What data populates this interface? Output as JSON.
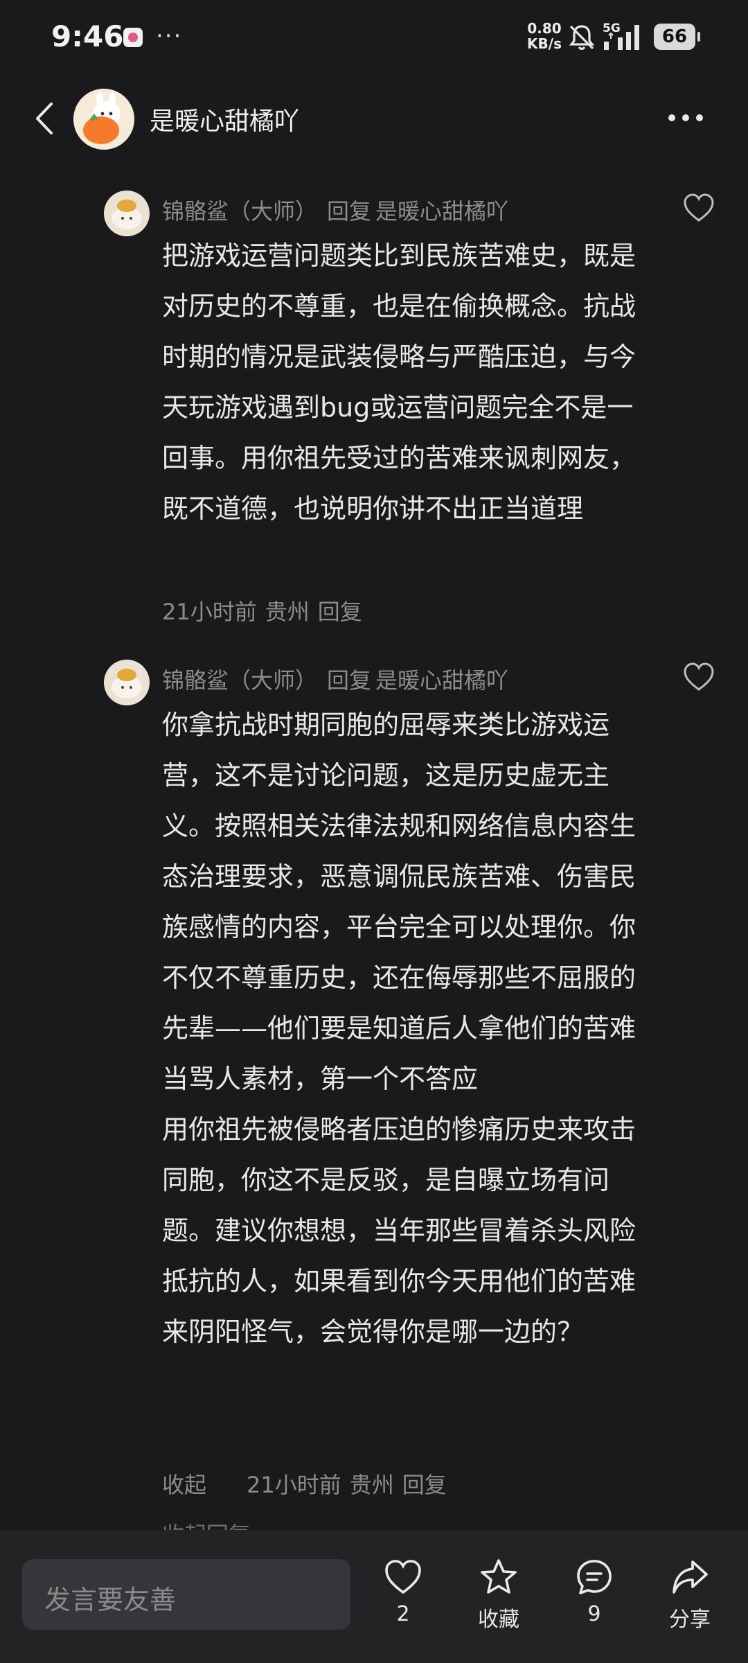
{
  "status_bar": {
    "time": "9:46",
    "dots": "···",
    "net_speed_value": "0.80",
    "net_speed_unit": "KB/s",
    "network": "5G",
    "battery": "66"
  },
  "header": {
    "title": "是暖心甜橘吖"
  },
  "comments": [
    {
      "author": "锦骼鲨（大师）",
      "reply_word": "回复",
      "reply_to": "是暖心甜橘吖",
      "body": "把游戏运营问题类比到民族苦难史，既是对历史的不尊重，也是在偷换概念。抗战时期的情况是武装侵略与严酷压迫，与今天玩游戏遇到bug或运营问题完全不是一回事。用你祖先受过的苦难来讽刺网友，既不道德，也说明你讲不出正当道理",
      "time": "21小时前",
      "location": "贵州",
      "reply_action": "回复"
    },
    {
      "author": "锦骼鲨（大师）",
      "reply_word": "回复",
      "reply_to": "是暖心甜橘吖",
      "body": "你拿抗战时期同胞的屈辱来类比游戏运营，这不是讨论问题，这是历史虚无主义。按照相关法律法规和网络信息内容生态治理要求，恶意调侃民族苦难、伤害民族感情的内容，平台完全可以处理你。你不仅不尊重历史，还在侮辱那些不屈服的先辈——他们要是知道后人拿他们的苦难当骂人素材，第一个不答应\n用你祖先被侵略者压迫的惨痛历史来攻击同胞，你这不是反驳，是自曝立场有问题。建议你想想，当年那些冒着杀头风险抵抗的人，如果看到你今天用他们的苦难来阴阳怪气，会觉得你是哪一边的？",
      "collapse": "收起",
      "time": "21小时前",
      "location": "贵州",
      "reply_action": "回复"
    }
  ],
  "peek_text": "收起回复",
  "bottom_bar": {
    "input_placeholder": "发言要友善",
    "like_count": "2",
    "favorite_label": "收藏",
    "comment_count": "9",
    "share_label": "分享"
  }
}
